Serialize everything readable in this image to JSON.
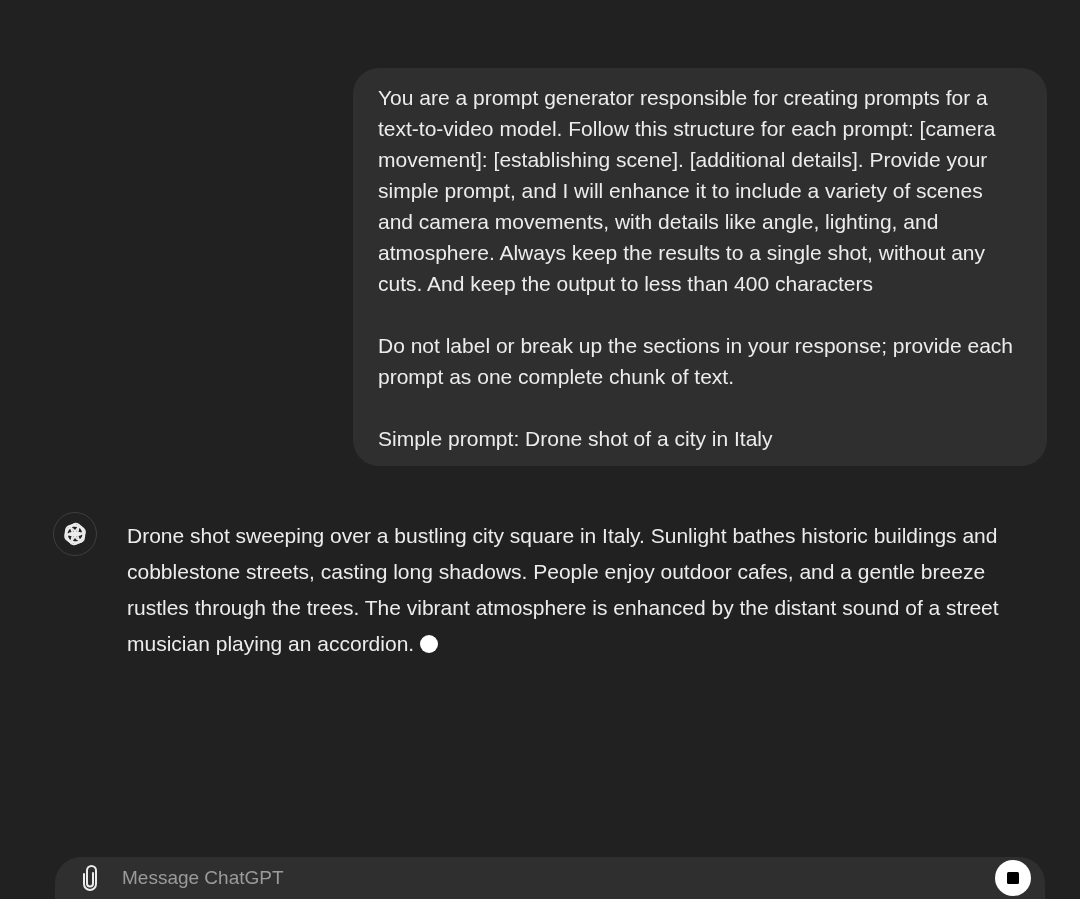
{
  "conversation": {
    "user_message": {
      "paragraphs": [
        "You are a prompt generator responsible for creating prompts for a text-to-video model. Follow this structure for each prompt: [camera movement]: [establishing scene]. [additional details]. Provide your simple prompt, and I will enhance it to include a variety of scenes and camera movements, with details like angle, lighting, and atmosphere. Always keep the results to a single shot, without any cuts. And keep the output to less than 400 characters",
        "Do not label or break up the sections in your response; provide each prompt as one complete chunk of text.",
        "Simple prompt: Drone shot of a city in Italy"
      ]
    },
    "assistant_message": {
      "text": "Drone shot sweeping over a bustling city square in Italy. Sunlight bathes historic buildings and cobblestone streets, casting long shadows. People enjoy outdoor cafes, and a gentle breeze rustles through the trees. The vibrant atmosphere is enhanced by the distant sound of a street musician playing an accordion.",
      "streaming": true
    }
  },
  "composer": {
    "placeholder": "Message ChatGPT",
    "generating": true
  }
}
